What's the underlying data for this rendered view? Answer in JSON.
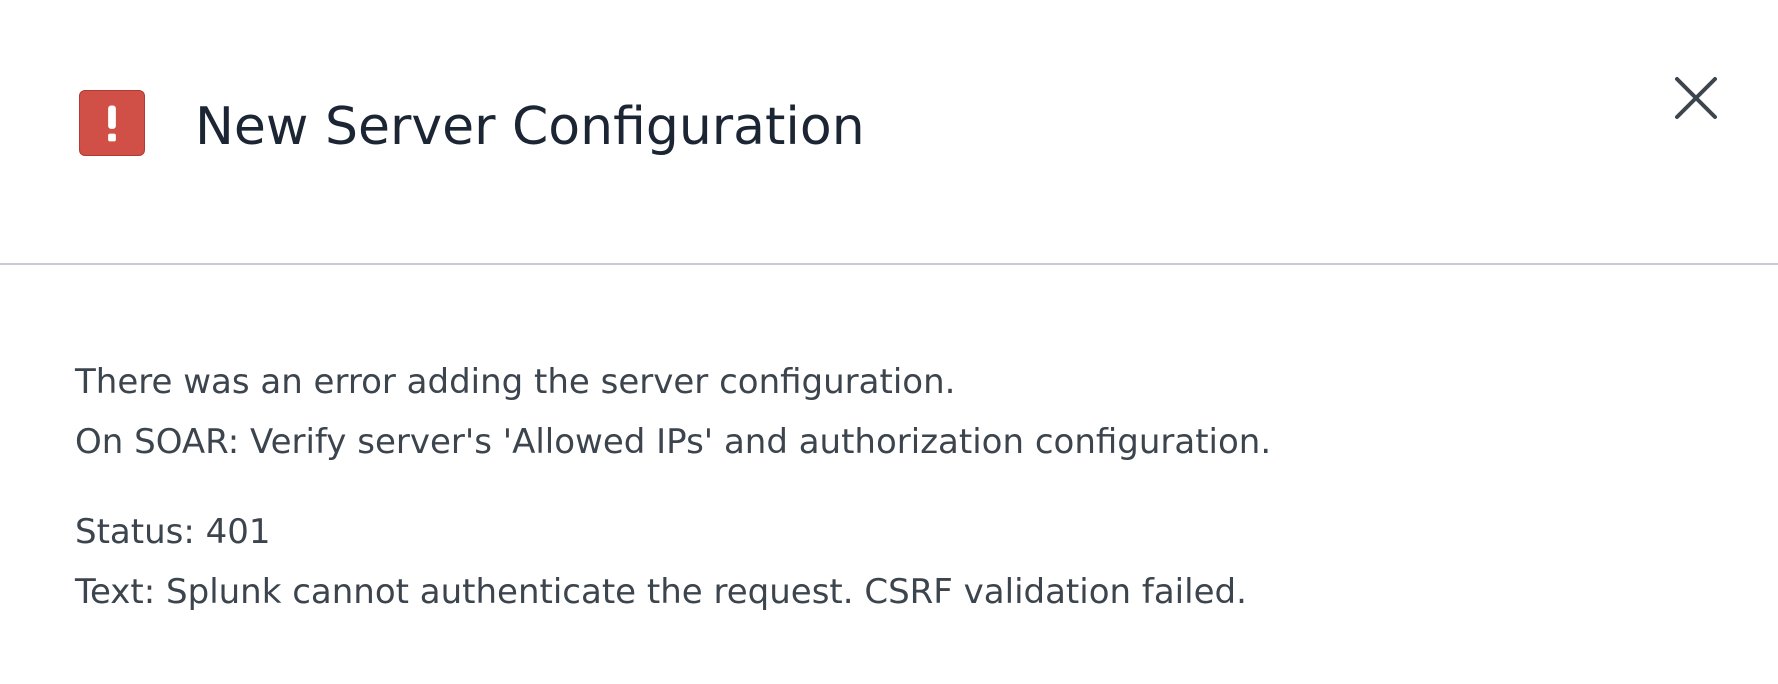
{
  "dialog": {
    "title": "New Server Configuration",
    "icon": "error-icon",
    "close_icon": "close-icon",
    "accent_color": "#d04f47"
  },
  "message": {
    "line1": "There was an error adding the server configuration.",
    "line2": "On SOAR: Verify server's 'Allowed IPs' and authorization configuration.",
    "status": "Status: 401",
    "text": "Text: Splunk cannot authenticate the request. CSRF validation failed."
  }
}
